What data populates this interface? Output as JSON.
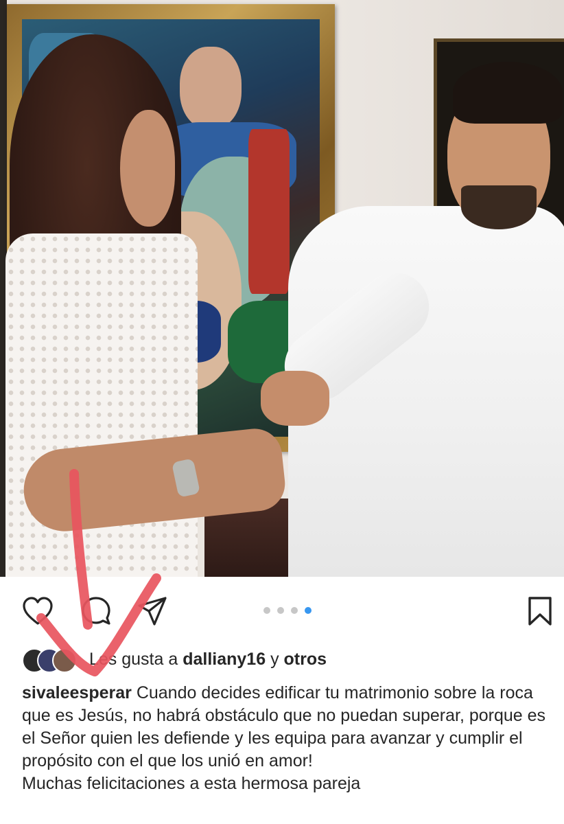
{
  "post": {
    "image": {
      "description_tag": "couple-photo",
      "carousel": {
        "count": 4,
        "active_index": 3
      }
    },
    "actions": {
      "like_icon": "heart-icon",
      "comment_icon": "comment-icon",
      "share_icon": "paper-plane-icon",
      "save_icon": "bookmark-icon"
    },
    "likes": {
      "prefix": "Les gusta a ",
      "user": "dalliany16",
      "connector": " y ",
      "others": "otros"
    },
    "caption": {
      "username": "sivaleesperar",
      "text": "Cuando decides edificar tu matrimonio sobre la roca que es Jesús, no habrá obstáculo que no puedan superar, porque es el Señor quien les defiende y les equipa para avanzar y cumplir el propósito con el que los unió en amor!",
      "second_line": "Muchas felicitaciones a esta hermosa pareja"
    }
  },
  "colors": {
    "accent_dot": "#3897f0",
    "inactive_dot": "#c7c7c7",
    "annotation_red": "#e8555e",
    "text": "#262626"
  }
}
